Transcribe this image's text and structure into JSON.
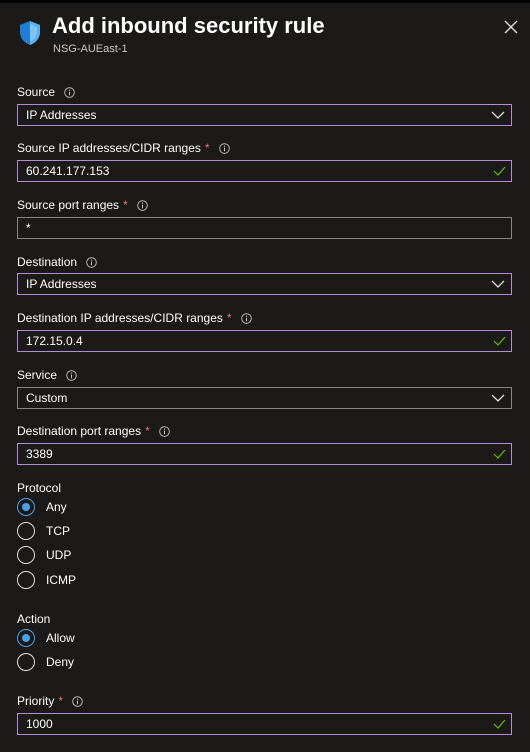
{
  "header": {
    "title": "Add inbound security rule",
    "subtitle": "NSG-AUEast-1"
  },
  "fields": {
    "source": {
      "label": "Source",
      "value": "IP Addresses"
    },
    "source_ip": {
      "label": "Source IP addresses/CIDR ranges",
      "required": "*",
      "value": "60.241.177.153"
    },
    "source_port": {
      "label": "Source port ranges",
      "required": "*",
      "value": "*"
    },
    "destination": {
      "label": "Destination",
      "value": "IP Addresses"
    },
    "destination_ip": {
      "label": "Destination IP addresses/CIDR ranges",
      "required": "*",
      "value": "172.15.0.4"
    },
    "service": {
      "label": "Service",
      "value": "Custom"
    },
    "destination_port": {
      "label": "Destination port ranges",
      "required": "*",
      "value": "3389"
    },
    "priority": {
      "label": "Priority",
      "required": "*",
      "value": "1000"
    }
  },
  "protocol": {
    "label": "Protocol",
    "options": [
      "Any",
      "TCP",
      "UDP",
      "ICMP"
    ],
    "selected": "Any"
  },
  "action": {
    "label": "Action",
    "options": [
      "Allow",
      "Deny"
    ],
    "selected": "Allow"
  },
  "colors": {
    "background": "#1b1a19",
    "accent": "#4aa0e6",
    "focus_border": "#b58cd6",
    "required": "#f1707b",
    "valid_check": "#6bb700"
  },
  "icons": {
    "header": "shield-icon",
    "close": "close-icon",
    "info": "info-icon",
    "dropdown": "chevron-down-icon",
    "valid": "checkmark-icon"
  }
}
